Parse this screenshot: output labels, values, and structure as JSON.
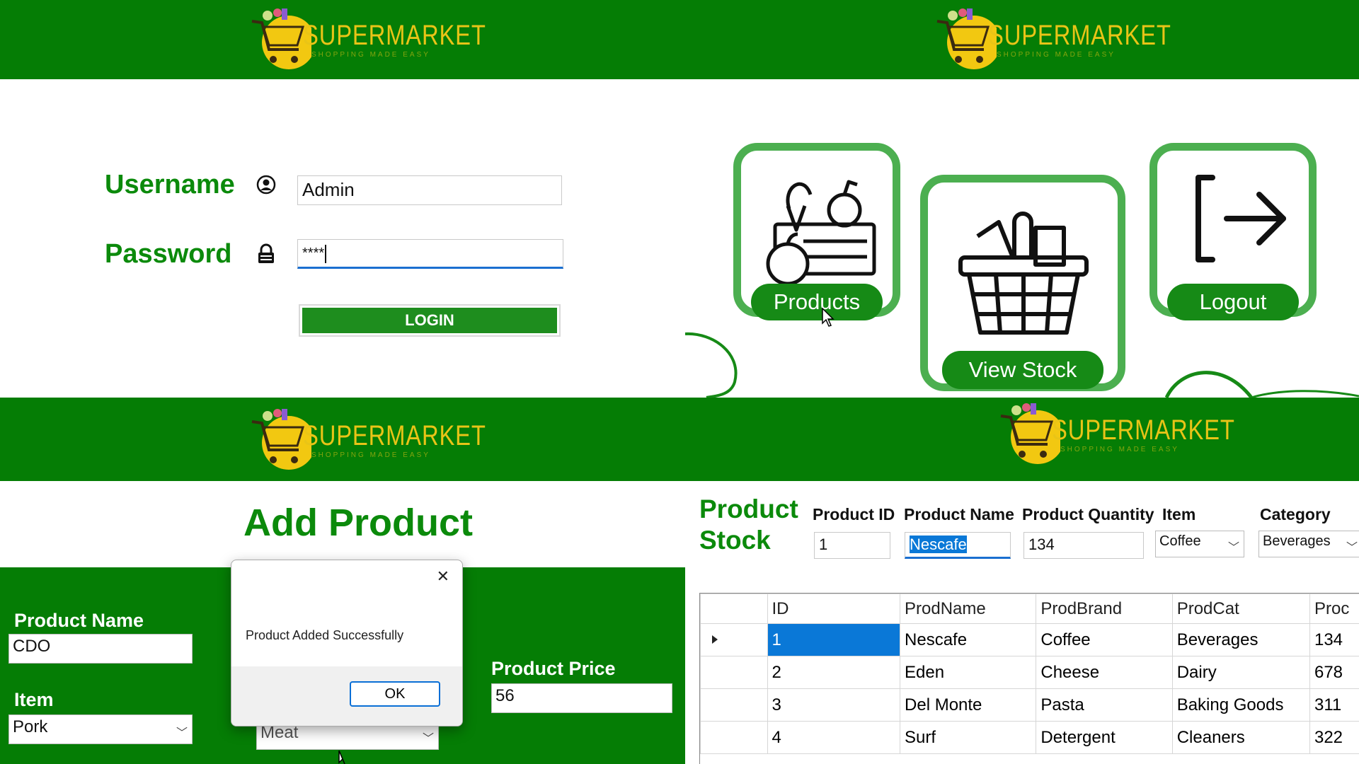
{
  "logo": {
    "brand": "SUPERMARKET",
    "tagline": "SHOPPING MADE EASY"
  },
  "login": {
    "username_label": "Username",
    "password_label": "Password",
    "username_value": "Admin",
    "password_value": "****",
    "login_button": "LOGIN"
  },
  "menu": {
    "products_label": "Products",
    "view_stock_label": "View Stock",
    "logout_label": "Logout"
  },
  "add_product": {
    "title": "Add Product",
    "product_name_label": "Product Name",
    "product_name_value": "CDO",
    "item_label": "Item",
    "item_value": "Pork",
    "category_value": "Meat",
    "product_price_label": "Product Price",
    "product_price_value": "56",
    "dialog": {
      "close": "✕",
      "message": "Product Added Successfully",
      "ok": "OK"
    }
  },
  "stock": {
    "title_line1": "Product",
    "title_line2": "Stock",
    "fields": {
      "product_id_label": "Product ID",
      "product_name_label": "Product Name",
      "product_quantity_label": "Product Quantity",
      "item_label": "Item",
      "category_label": "Category",
      "product_id_value": "1",
      "product_name_value": "Nescafe",
      "product_quantity_value": "134",
      "item_value": "Coffee",
      "category_value": "Beverages"
    },
    "columns": [
      "ID",
      "ProdName",
      "ProdBrand",
      "ProdCat",
      "Proc"
    ],
    "rows": [
      [
        "1",
        "Nescafe",
        "Coffee",
        "Beverages",
        "134"
      ],
      [
        "2",
        "Eden",
        "Cheese",
        "Dairy",
        "678"
      ],
      [
        "3",
        "Del Monte",
        "Pasta",
        "Baking Goods",
        "311"
      ],
      [
        "4",
        "Surf",
        "Detergent",
        "Cleaners",
        "322"
      ]
    ]
  },
  "colors": {
    "banner": "#057d05",
    "accent": "#4caf50",
    "selection": "#0a78d7",
    "logo_yellow": "#e9c417"
  }
}
